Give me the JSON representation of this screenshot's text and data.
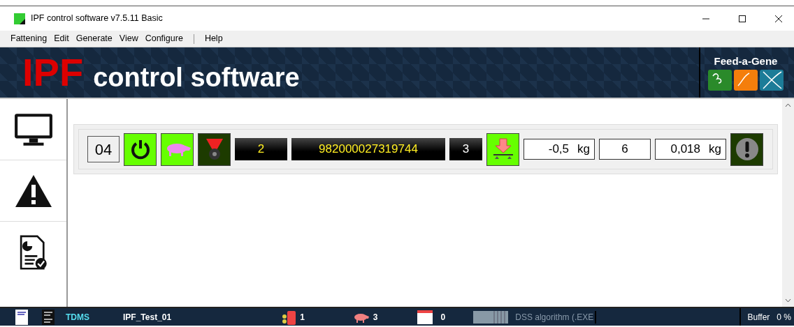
{
  "window": {
    "title": "IPF control software v7.5.11 Basic"
  },
  "menu": [
    {
      "label": "Fattening"
    },
    {
      "label": "Edit"
    },
    {
      "label": "Generate"
    },
    {
      "label": "View"
    },
    {
      "label": "Configure"
    },
    {
      "kind": "separator"
    },
    {
      "label": "Help"
    }
  ],
  "banner": {
    "acronym": "IPF",
    "title": "control software",
    "logo": "Feed-a-Gene"
  },
  "sidebar": {
    "items": [
      {
        "kind": "monitor"
      },
      {
        "kind": "warning"
      },
      {
        "kind": "report"
      }
    ]
  },
  "feeder_row": [
    {
      "kind": "id",
      "text": "04"
    },
    {
      "kind": "power"
    },
    {
      "kind": "pig"
    },
    {
      "kind": "valve"
    },
    {
      "kind": "dark",
      "text": "2"
    },
    {
      "kind": "dark",
      "text": "982000027319744",
      "wide": true
    },
    {
      "kind": "dark",
      "text": "3",
      "white": true
    },
    {
      "kind": "scale"
    },
    {
      "kind": "weight",
      "value": "-0,5",
      "unit": "kg"
    },
    {
      "kind": "box",
      "text": "6"
    },
    {
      "kind": "weight",
      "value": "0,018",
      "unit": "kg"
    },
    {
      "kind": "alert"
    }
  ],
  "status_bar": {
    "mode": "TDMS",
    "test": "IPF_Test_01",
    "feeders": "1",
    "animals": "3",
    "days": "0",
    "algorithm": "DSS algorithm (.EXE",
    "buffer_label": "Buffer",
    "buffer_value": "0 %"
  }
}
